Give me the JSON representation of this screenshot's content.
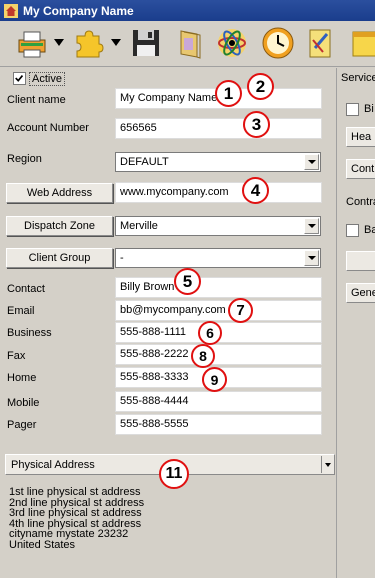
{
  "window": {
    "title": "My Company Name"
  },
  "toolbar": {
    "icons": [
      "print-icon",
      "puzzle-icon",
      "save-icon",
      "book-icon",
      "atom-icon",
      "clock-icon",
      "notes-icon",
      "sticky-note-icon"
    ]
  },
  "active": {
    "label": "Active",
    "checked": true
  },
  "fields": {
    "client_name": {
      "label": "Client name",
      "value": "My Company Name"
    },
    "account_number": {
      "label": "Account Number",
      "value": "656565"
    },
    "region": {
      "label": "Region",
      "value": "DEFAULT"
    },
    "web_address": {
      "button": "Web Address",
      "value": "www.mycompany.com"
    },
    "dispatch_zone": {
      "button": "Dispatch Zone",
      "value": "Merville"
    },
    "client_group": {
      "button": "Client Group",
      "value": "-"
    },
    "contact": {
      "label": "Contact",
      "value": "Billy Brown"
    },
    "email": {
      "label": "Email",
      "value": "bb@mycompany.com"
    },
    "business": {
      "label": "Business",
      "value": "555-888-1111"
    },
    "fax": {
      "label": "Fax",
      "value": "555-888-2222"
    },
    "home": {
      "label": "Home",
      "value": "555-888-3333"
    },
    "mobile": {
      "label": "Mobile",
      "value": "555-888-4444"
    },
    "pager": {
      "label": "Pager",
      "value": "555-888-5555"
    }
  },
  "address": {
    "selector": "Physical Address",
    "lines": [
      "1st line physical st address",
      "2nd line physical st address",
      "3rd line physical st address",
      "4th line physical st address",
      "cityname mystate  23232",
      "United States"
    ]
  },
  "right_panel": {
    "service_label": "Service",
    "chk1_label": "Bi",
    "btn1": "Hea",
    "btn2": "Cont",
    "contract_label": "Contra",
    "chk2_label": "Ba",
    "btn4": "Gene"
  },
  "callouts": [
    "1",
    "2",
    "3",
    "4",
    "5",
    "6",
    "7",
    "8",
    "9",
    "11"
  ],
  "colors": {
    "title_bar": "#1a3d8c",
    "callout_ring": "#e01010"
  }
}
